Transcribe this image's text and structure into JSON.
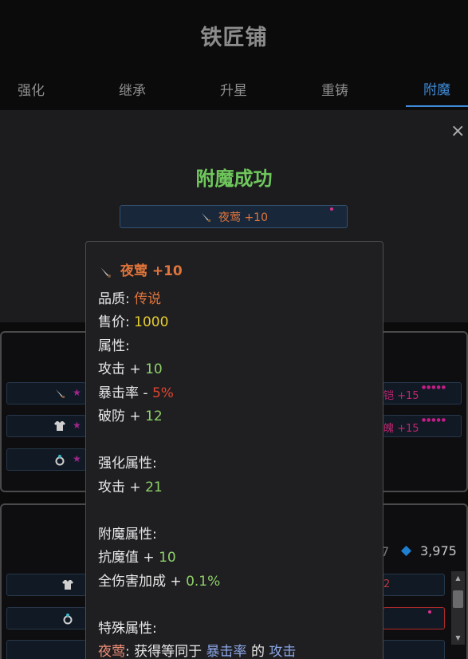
{
  "header": {
    "title": "铁匠铺"
  },
  "tabs": [
    {
      "label": "强化"
    },
    {
      "label": "继承"
    },
    {
      "label": "升星"
    },
    {
      "label": "重铸"
    },
    {
      "label": "附魔",
      "active": true
    }
  ],
  "background": {
    "row_right_1": "铠 +15",
    "row_right_2": "魄 +15",
    "currency_left": "7",
    "currency_value": "3,975",
    "row_partial": "2"
  },
  "modal": {
    "close_label": "×",
    "success_title": "附魔成功",
    "item_chip": "夜莺 +10"
  },
  "tooltip": {
    "item_name": "夜莺 +10",
    "quality_label": "品质:",
    "quality_value": "传说",
    "price_label": "售价:",
    "price_value": "1000",
    "attributes_label": "属性:",
    "attr_attack_label": "攻击 +",
    "attr_attack_value": "10",
    "attr_crit_label": "暴击率 -",
    "attr_crit_value": "5%",
    "attr_pierce_label": "破防 +",
    "attr_pierce_value": "12",
    "enhance_label": "强化属性:",
    "enhance_attack_label": "攻击 +",
    "enhance_attack_value": "21",
    "enchant_label": "附魔属性:",
    "enchant_magic_label": "抗魔值 +",
    "enchant_magic_value": "10",
    "enchant_dmg_label": "全伤害加成 +",
    "enchant_dmg_value": "0.1%",
    "special_label": "特殊属性:",
    "special_name": "夜莺",
    "special_text_1": ":  获得等同于",
    "special_highlight_1": "暴击率",
    "special_text_2": "的",
    "special_highlight_2": "攻击"
  },
  "colors": {
    "accent_blue": "#3f8ad6",
    "success_green": "#6fc75c",
    "legendary_orange": "#e0743a",
    "price_yellow": "#e6cc2e",
    "positive_green": "#8fd169",
    "negative_red": "#e0452f"
  },
  "icons": {
    "knife": "knife-icon",
    "armor": "armor-icon",
    "ring": "ring-icon",
    "star": "star-icon",
    "diamond": "diamond-icon",
    "close": "close-icon"
  }
}
